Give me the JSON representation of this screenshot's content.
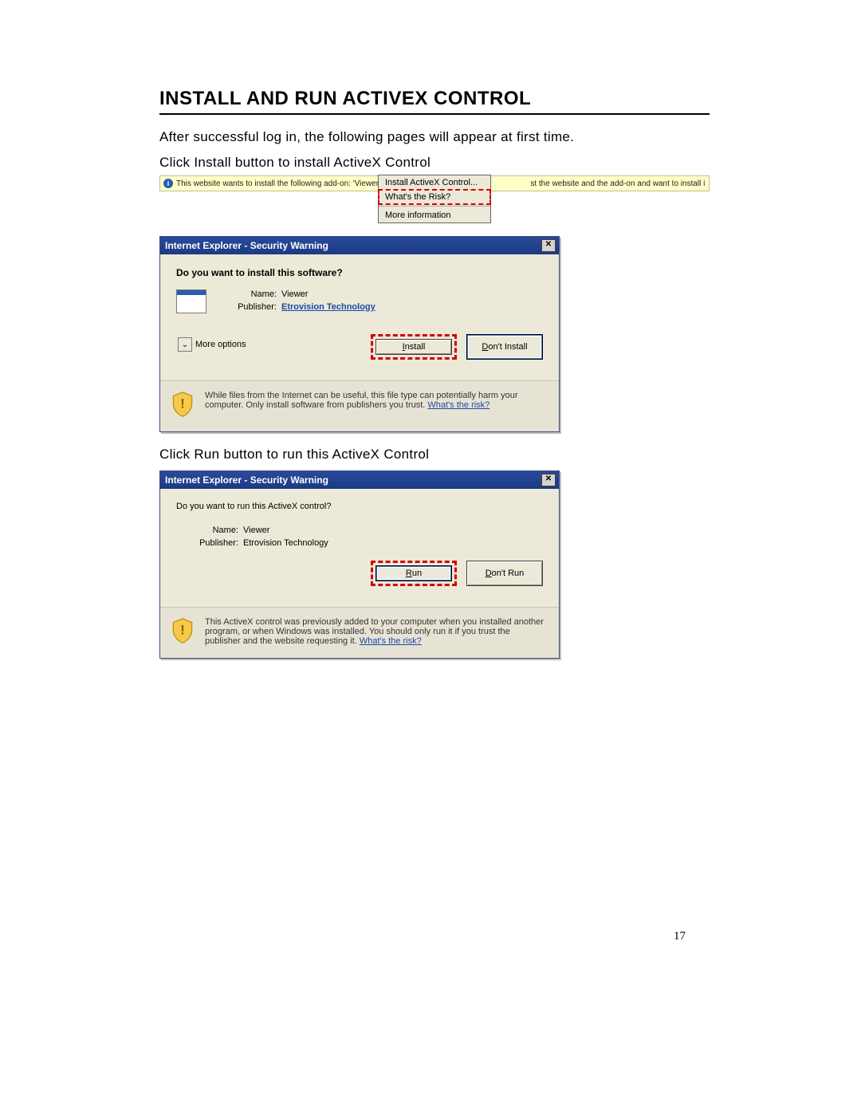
{
  "heading": "INSTALL AND RUN ACTIVEX CONTROL",
  "intro": "After successful log in, the following pages will appear at first time.",
  "instruction_install": "Click Install button to install ActiveX Control",
  "instruction_run": "Click Run button to run this ActiveX Control",
  "ie_bar_left": "This website wants to install the following add-on: 'Viewer' from",
  "ie_bar_right": "st the website and the add-on and want to install it, click here...",
  "context_menu": {
    "install": "Install ActiveX Control...",
    "risk": "What's the Risk?",
    "more": "More information"
  },
  "dialog": {
    "title": "Internet Explorer - Security Warning",
    "question": "Do you want to install this software?",
    "name_label": "Name:",
    "name_value": "Viewer",
    "publisher_label": "Publisher:",
    "publisher_value": "Etrovision Technology",
    "more_options": "More options",
    "install_btn": "Install",
    "dont_install_btn": "Don't Install",
    "footer_text": "While files from the Internet can be useful, this file type can potentially harm your computer. Only install software from publishers you trust. ",
    "footer_link": "What's the risk?"
  },
  "dialog2": {
    "title": "Internet Explorer - Security Warning",
    "question": "Do you want to run this ActiveX control?",
    "name_label": "Name:",
    "name_value": "Viewer",
    "publisher_label": "Publisher:",
    "publisher_value": "Etrovision Technology",
    "run_btn": "Run",
    "dont_run_btn": "Don't Run",
    "footer_text": "This ActiveX control was previously added to your computer when you installed another program, or when Windows was installed. You should only run it if you trust the publisher and the website requesting it. ",
    "footer_link": "What's the risk?"
  },
  "page_number": "17"
}
